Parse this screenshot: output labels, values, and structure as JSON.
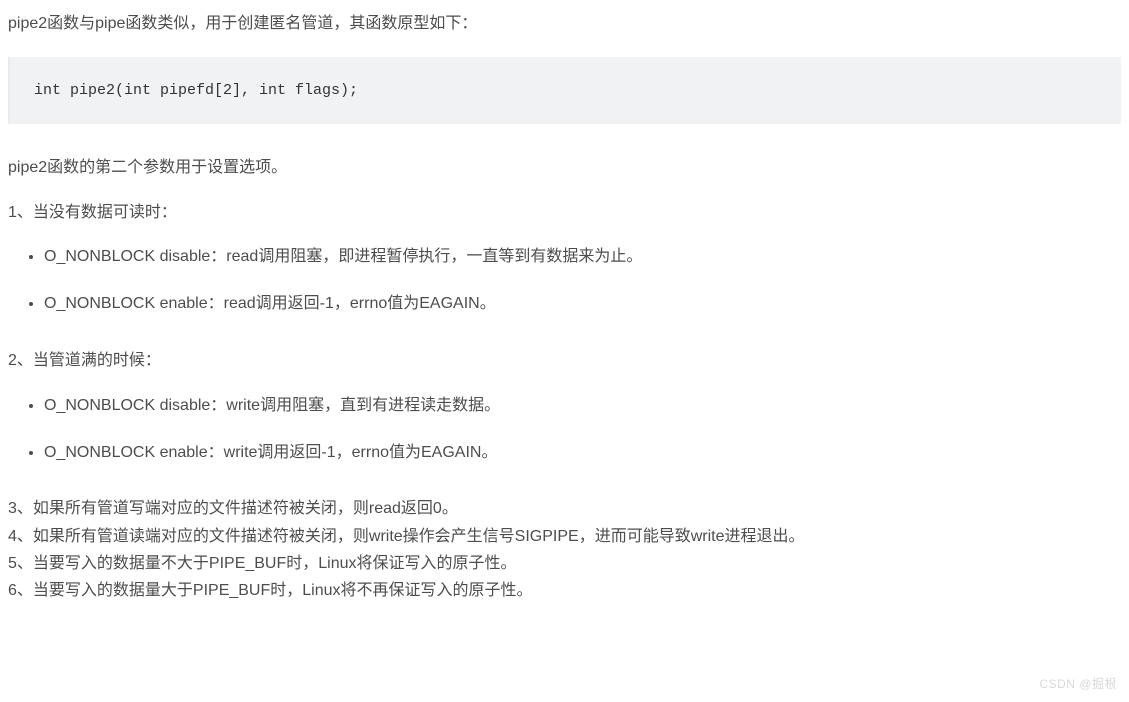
{
  "intro": "pipe2函数与pipe函数类似，用于创建匿名管道，其函数原型如下：",
  "code": "int pipe2(int pipefd[2], int flags);",
  "param_desc": "pipe2函数的第二个参数用于设置选项。",
  "section1_label": "1、当没有数据可读时：",
  "section1_items": [
    "O_NONBLOCK disable：read调用阻塞，即进程暂停执行，一直等到有数据来为止。",
    "O_NONBLOCK enable：read调用返回-1，errno值为EAGAIN。"
  ],
  "section2_label": "2、当管道满的时候：",
  "section2_items": [
    "O_NONBLOCK disable：write调用阻塞，直到有进程读走数据。",
    "O_NONBLOCK enable：write调用返回-1，errno值为EAGAIN。"
  ],
  "lines": [
    "3、如果所有管道写端对应的文件描述符被关闭，则read返回0。",
    "4、如果所有管道读端对应的文件描述符被关闭，则write操作会产生信号SIGPIPE，进而可能导致write进程退出。",
    "5、当要写入的数据量不大于PIPE_BUF时，Linux将保证写入的原子性。",
    "6、当要写入的数据量大于PIPE_BUF时，Linux将不再保证写入的原子性。"
  ],
  "watermark": "CSDN @掘根"
}
